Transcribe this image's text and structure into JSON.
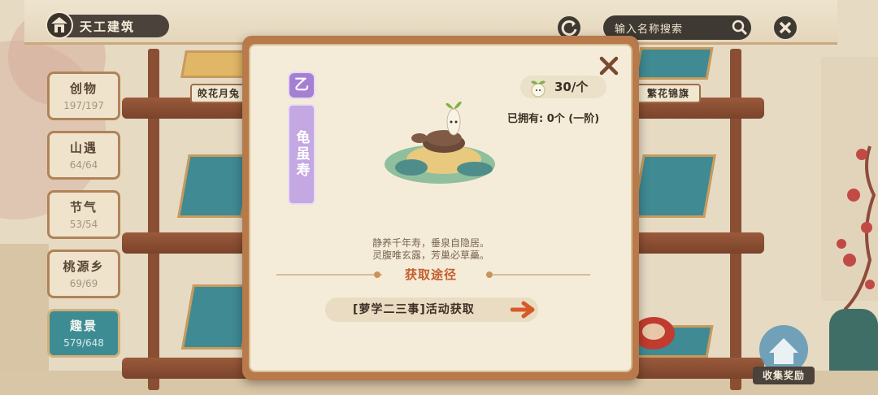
{
  "header": {
    "title": "天工建筑",
    "search_placeholder": "输入名称搜索"
  },
  "sidebar": {
    "items": [
      {
        "label": "创物",
        "count": "197/197"
      },
      {
        "label": "山遇",
        "count": "64/64"
      },
      {
        "label": "节气",
        "count": "53/54"
      },
      {
        "label": "桃源乡",
        "count": "69/69"
      },
      {
        "label": "趣景",
        "count": "579/648"
      }
    ],
    "active_index": 4
  },
  "shelf": {
    "tags": [
      "皎花月兔",
      "繁花锦旗"
    ]
  },
  "modal": {
    "rarity": "乙",
    "item_name": "龟虽寿",
    "price": "30/个",
    "owned": "已拥有: 0个 (一阶)",
    "description_lines": [
      "静养千年寿，垂泉自隐居。",
      "灵腹唯玄露，芳巢必草蘽。"
    ],
    "section_title": "获取途径",
    "source": "[萝学二三事]活动获取"
  },
  "collect_button": "收集奖励",
  "colors": {
    "accent_teal": "#3d8c93",
    "rarity_purple": "#a57fd2",
    "section_orange": "#c55e2e"
  }
}
